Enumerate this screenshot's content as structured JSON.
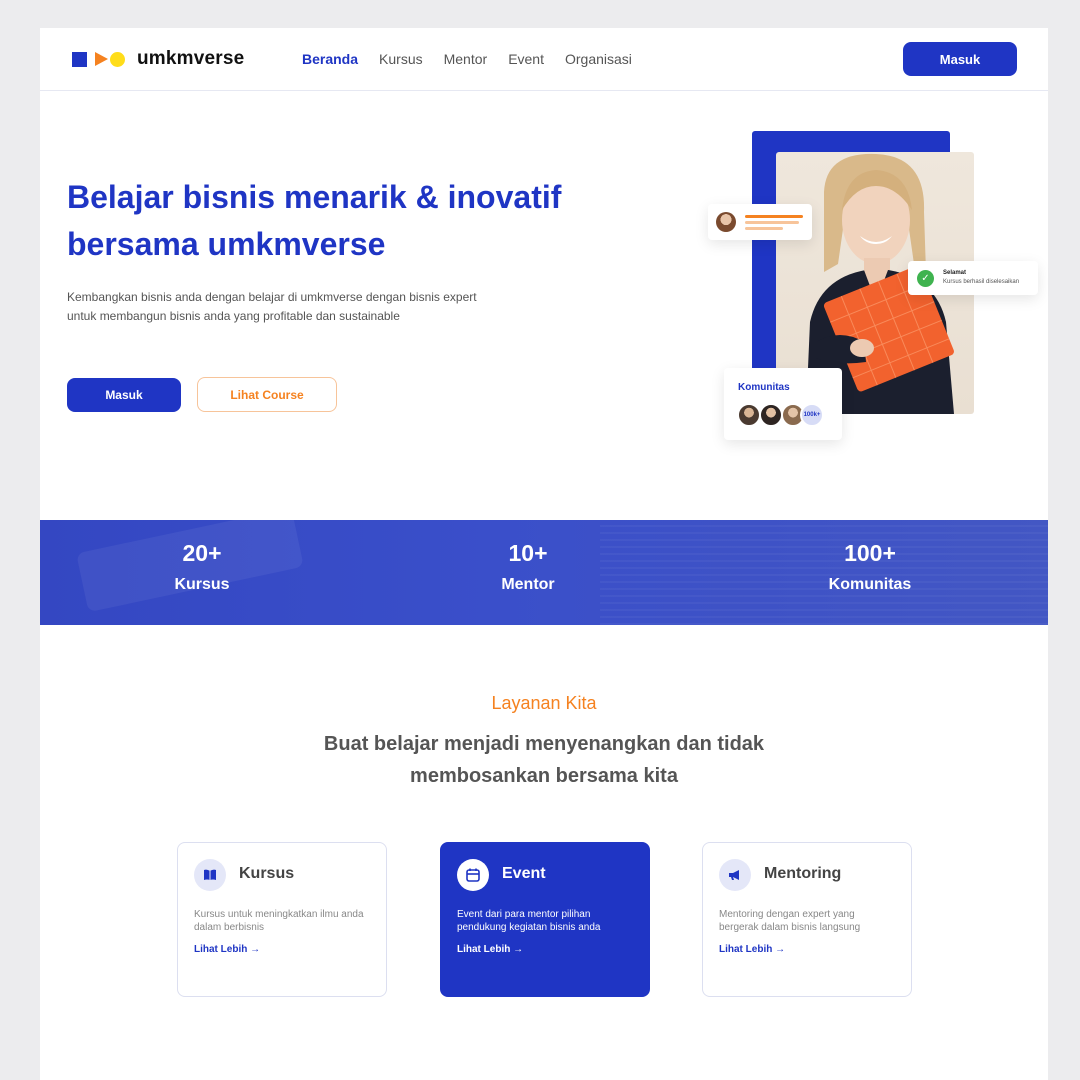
{
  "brand": {
    "name": "umkmverse",
    "colors": {
      "primary": "#1f35c4",
      "accent": "#f58220",
      "yellow": "#ffdd1a",
      "success": "#3fb34f"
    }
  },
  "nav": {
    "items": [
      {
        "label": "Beranda",
        "active": true
      },
      {
        "label": "Kursus"
      },
      {
        "label": "Mentor"
      },
      {
        "label": "Event"
      },
      {
        "label": "Organisasi"
      }
    ],
    "login_label": "Masuk"
  },
  "hero": {
    "title_line1": "Belajar bisnis menarik & inovatif",
    "title_line2": "bersama umkmverse",
    "desc_line1": "Kembangkan bisnis anda dengan belajar di umkmverse dengan bisnis expert",
    "desc_line2": "untuk membangun bisnis anda yang profitable dan sustainable",
    "primary_button": "Masuk",
    "secondary_button": "Lihat Course",
    "notification": {
      "title": "Selamat",
      "text": "Kursus berhasil diselesaikan"
    },
    "community": {
      "title": "Komunitas",
      "count": "100k+"
    }
  },
  "stats": [
    {
      "number": "20+",
      "label": "Kursus"
    },
    {
      "number": "10+",
      "label": "Mentor"
    },
    {
      "number": "100+",
      "label": "Komunitas"
    }
  ],
  "services": {
    "kicker": "Layanan Kita",
    "title_line1": "Buat belajar menjadi menyenangkan dan tidak",
    "title_line2": "membosankan bersama kita",
    "cards": [
      {
        "title": "Kursus",
        "icon": "book-icon",
        "desc_line1": "Kursus untuk meningkatkan ilmu anda",
        "desc_line2": "dalam berbisnis",
        "link": "Lihat Lebih →"
      },
      {
        "title": "Event",
        "icon": "calendar-icon",
        "desc_line1": "Event dari para mentor pilihan",
        "desc_line2": "pendukung kegiatan bisnis anda",
        "link": "Lihat Lebih →"
      },
      {
        "title": "Mentoring",
        "icon": "megaphone-icon",
        "desc_line1": "Mentoring dengan expert yang",
        "desc_line2": "bergerak dalam bisnis langsung",
        "link": "Lihat Lebih →"
      }
    ]
  }
}
